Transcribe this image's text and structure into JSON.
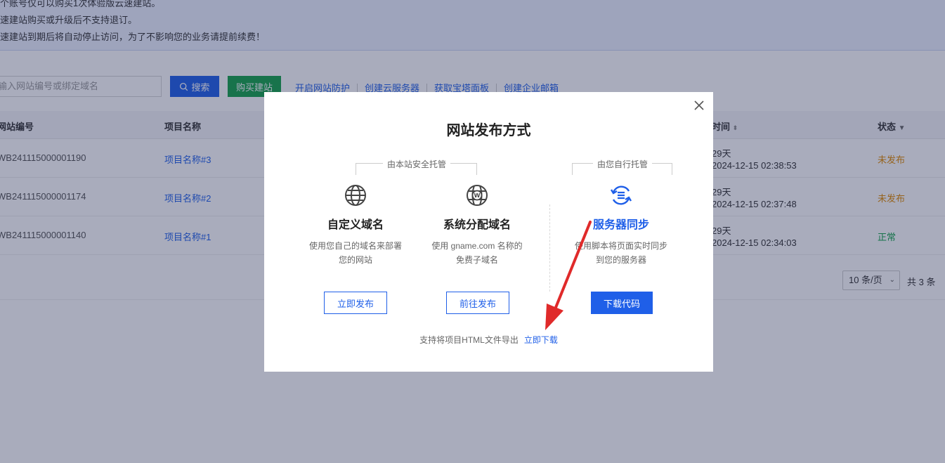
{
  "notice": {
    "lines": [
      "个账号仅可以购买1次体验版云速建站。",
      "速建站购买或升级后不支持退订。",
      "速建站到期后将自动停止访问，为了不影响您的业务请提前续费！"
    ]
  },
  "toolbar": {
    "search_placeholder": "输入网站编号或绑定域名",
    "search_label": "搜索",
    "buy_label": "购买建站",
    "links": [
      "开启网站防护",
      "创建云服务器",
      "获取宝塔面板",
      "创建企业邮箱"
    ]
  },
  "table": {
    "headers": {
      "id": "网站编号",
      "name": "项目名称",
      "time": "时间",
      "status": "状态"
    },
    "rows": [
      {
        "id": "WB241115000001190",
        "name": "项目名称#3",
        "days": "29天",
        "time": "2024-12-15 02:38:53",
        "status": "未发布"
      },
      {
        "id": "WB241115000001174",
        "name": "项目名称#2",
        "days": "29天",
        "time": "2024-12-15 02:37:48",
        "status": "未发布"
      },
      {
        "id": "WB241115000001140",
        "name": "项目名称#1",
        "days": "29天",
        "time": "2024-12-15 02:34:03",
        "status": "正常"
      }
    ]
  },
  "pager": {
    "page_size": "10 条/页",
    "total": "共 3 条"
  },
  "modal": {
    "title": "网站发布方式",
    "group_hosted": "由本站安全托管",
    "group_self": "由您自行托管",
    "options": [
      {
        "icon": "globe-icon",
        "title": "自定义域名",
        "desc": [
          "使用您自己的域名来部署",
          "您的网站"
        ],
        "button": "立即发布"
      },
      {
        "icon": "globe-w-icon",
        "title": "系统分配域名",
        "desc": [
          "使用 gname.com 名称的",
          "免费子域名"
        ],
        "button": "前往发布"
      },
      {
        "icon": "sync-server-icon",
        "title": "服务器同步",
        "desc": [
          "使用脚本将页面实时同步",
          "到您的服务器"
        ],
        "button": "下载代码"
      }
    ],
    "footer_text": "支持将项目HTML文件导出",
    "footer_link": "立即下载"
  },
  "colors": {
    "accent": "#1f5fe8",
    "buy": "#16a34a",
    "pending": "#e08a00",
    "ok": "#16a34a"
  }
}
